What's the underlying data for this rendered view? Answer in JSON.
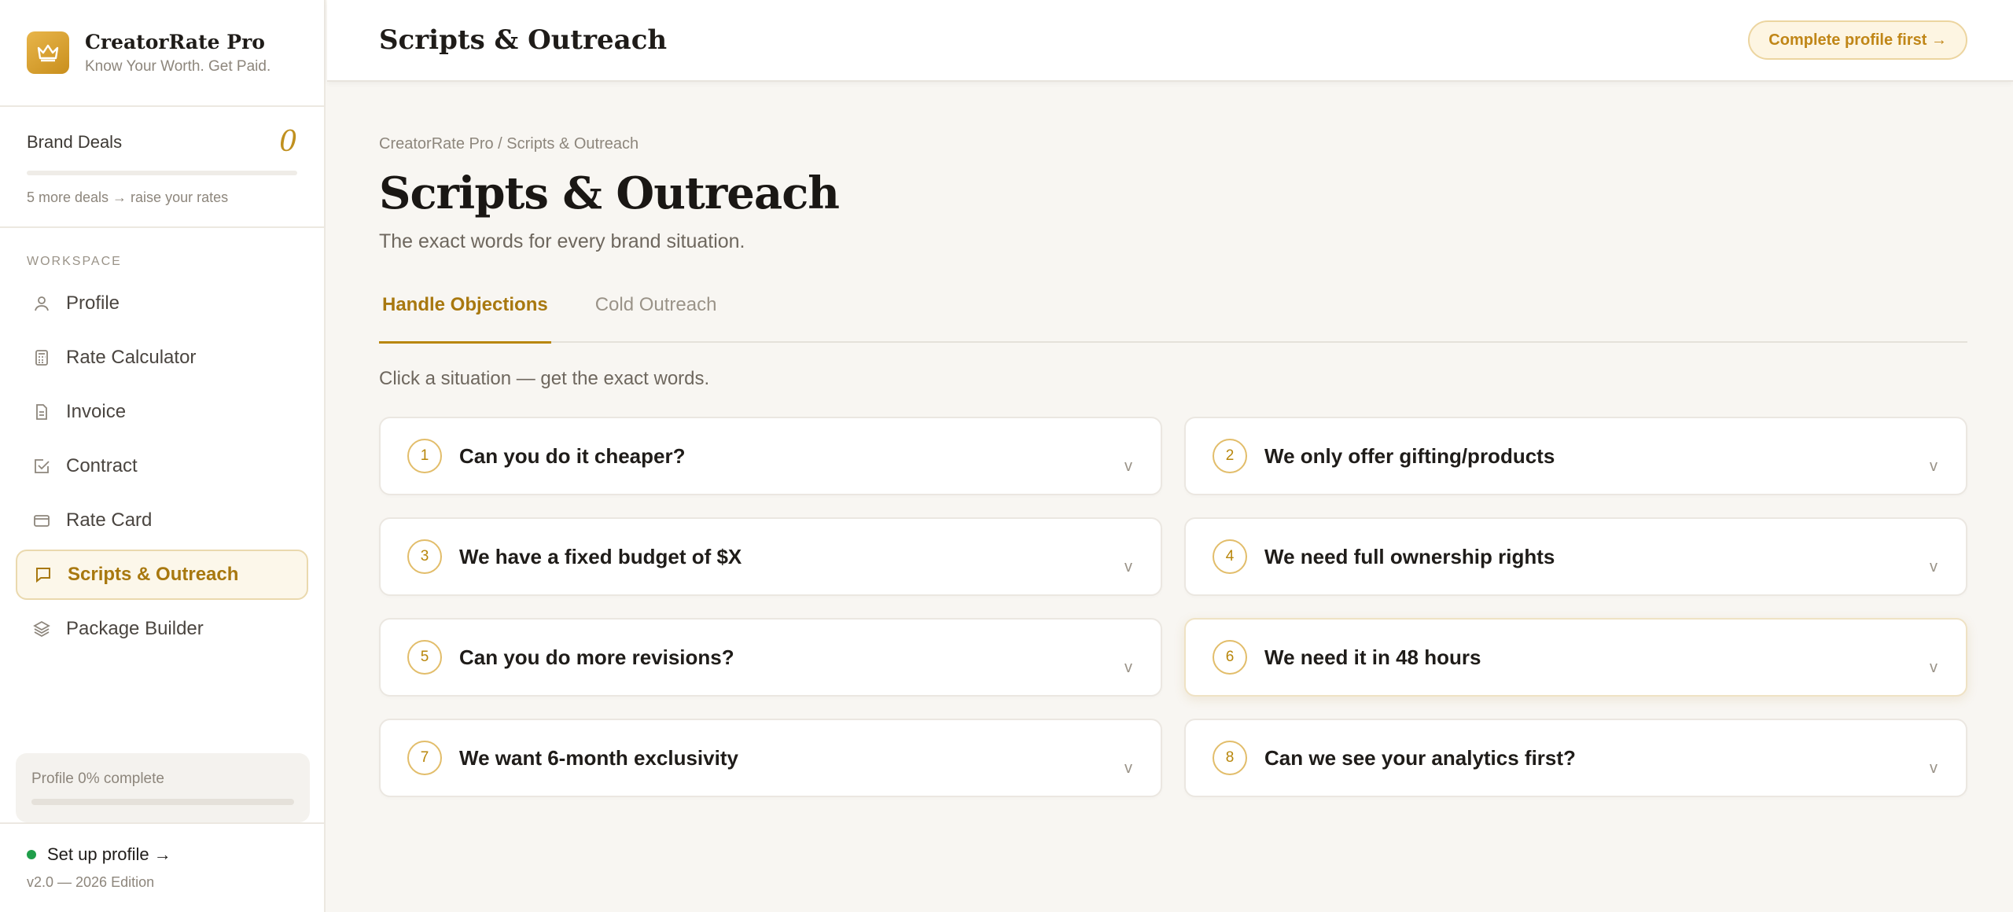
{
  "brand": {
    "name": "CreatorRate Pro",
    "tagline": "Know Your Worth. Get Paid."
  },
  "deals": {
    "label": "Brand Deals",
    "count": "0",
    "progress": 0,
    "note": "5 more deals → raise your rates"
  },
  "sidebar": {
    "section_label": "WORKSPACE",
    "items": [
      {
        "label": "Profile",
        "icon": "user-icon"
      },
      {
        "label": "Rate Calculator",
        "icon": "calculator-icon"
      },
      {
        "label": "Invoice",
        "icon": "document-icon"
      },
      {
        "label": "Contract",
        "icon": "checkbox-icon"
      },
      {
        "label": "Rate Card",
        "icon": "card-icon"
      },
      {
        "label": "Scripts & Outreach",
        "icon": "chat-icon",
        "active": true
      },
      {
        "label": "Package Builder",
        "icon": "layers-icon"
      }
    ],
    "profile_card": {
      "label": "Profile 0% complete",
      "progress": 0
    },
    "footer": {
      "setup": "Set up profile →",
      "version": "v2.0 — 2026 Edition"
    }
  },
  "topbar": {
    "title": "Scripts & Outreach",
    "cta": "Complete profile first →"
  },
  "main": {
    "breadcrumb": "CreatorRate Pro / Scripts & Outreach",
    "title": "Scripts & Outreach",
    "subtitle": "The exact words for every brand situation.",
    "tabs": [
      "Handle Objections",
      "Cold Outreach"
    ],
    "hint": "Click a situation — get the exact words.",
    "situations": [
      {
        "num": "1",
        "text": "Can you do it cheaper?"
      },
      {
        "num": "2",
        "text": "We only offer gifting/products"
      },
      {
        "num": "3",
        "text": "We have a fixed budget of $X"
      },
      {
        "num": "4",
        "text": "We need full ownership rights"
      },
      {
        "num": "5",
        "text": "Can you do more revisions?"
      },
      {
        "num": "6",
        "text": "We need it in 48 hours"
      },
      {
        "num": "7",
        "text": "We want 6-month exclusivity"
      },
      {
        "num": "8",
        "text": "Can we see your analytics first?"
      }
    ],
    "chevron": "v"
  },
  "colors": {
    "accent": "#b8860b",
    "background": "#f8f6f2",
    "status_green": "#1f9e4a"
  }
}
